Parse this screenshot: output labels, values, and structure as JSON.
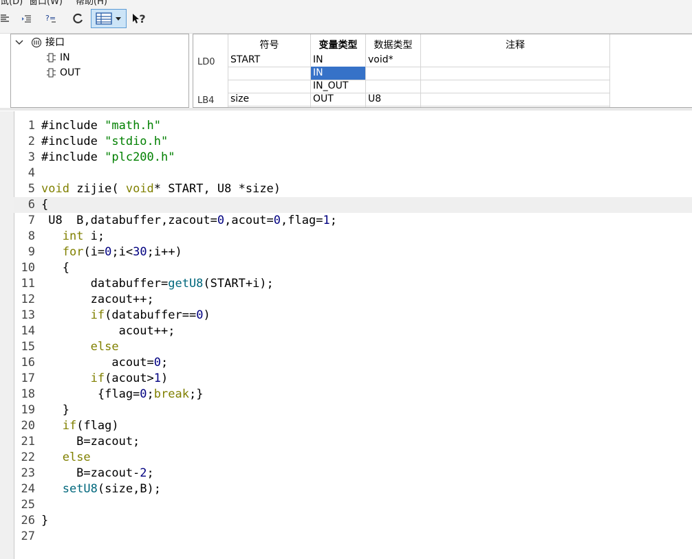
{
  "menu": [
    "试(D)",
    "窗口(W)",
    "帮助(H)"
  ],
  "toolbar": {
    "help_text": "?"
  },
  "tree": {
    "root": "接口",
    "children": [
      "IN",
      "OUT"
    ]
  },
  "grid": {
    "headers": [
      "符号",
      "变量类型",
      "数据类型",
      "注释"
    ],
    "row_labels": [
      "LD0",
      "LB4"
    ],
    "rows": [
      {
        "symbol": "START",
        "var_type": "IN",
        "data_type": "void*",
        "comment": ""
      },
      {
        "symbol": "",
        "var_type": "IN",
        "data_type": "",
        "comment": ""
      },
      {
        "symbol": "",
        "var_type": "IN_OUT",
        "data_type": "",
        "comment": ""
      },
      {
        "symbol": "size",
        "var_type": "OUT",
        "data_type": "U8",
        "comment": ""
      }
    ],
    "selected_row": 1
  },
  "editor": {
    "current_line": 6,
    "lines": [
      [
        [
          "p",
          "#include "
        ],
        [
          "s",
          "\"math.h\""
        ]
      ],
      [
        [
          "p",
          "#include "
        ],
        [
          "s",
          "\"stdio.h\""
        ]
      ],
      [
        [
          "p",
          "#include "
        ],
        [
          "s",
          "\"plc200.h\""
        ]
      ],
      [],
      [
        [
          "k",
          "void"
        ],
        [
          "p",
          " zijie( "
        ],
        [
          "k",
          "void"
        ],
        [
          "p",
          "* START, U8 *size)"
        ]
      ],
      [
        [
          "p",
          "{"
        ]
      ],
      [
        [
          "p",
          " U8  B,databuffer,zacout="
        ],
        [
          "n",
          "0"
        ],
        [
          "p",
          ",acout="
        ],
        [
          "n",
          "0"
        ],
        [
          "p",
          ",flag="
        ],
        [
          "n",
          "1"
        ],
        [
          "p",
          ";"
        ]
      ],
      [
        [
          "p",
          "   "
        ],
        [
          "k",
          "int"
        ],
        [
          "p",
          " i;"
        ]
      ],
      [
        [
          "p",
          "   "
        ],
        [
          "k",
          "for"
        ],
        [
          "p",
          "(i="
        ],
        [
          "n",
          "0"
        ],
        [
          "p",
          ";i<"
        ],
        [
          "n",
          "30"
        ],
        [
          "p",
          ";i++)"
        ]
      ],
      [
        [
          "p",
          "   {"
        ]
      ],
      [
        [
          "p",
          "       databuffer="
        ],
        [
          "f",
          "getU8"
        ],
        [
          "p",
          "(START+i);"
        ]
      ],
      [
        [
          "p",
          "       zacout++;"
        ]
      ],
      [
        [
          "p",
          "       "
        ],
        [
          "k",
          "if"
        ],
        [
          "p",
          "(databuffer=="
        ],
        [
          "n",
          "0"
        ],
        [
          "p",
          ")"
        ]
      ],
      [
        [
          "p",
          "           acout++;"
        ]
      ],
      [
        [
          "p",
          "       "
        ],
        [
          "k",
          "else"
        ]
      ],
      [
        [
          "p",
          "          acout="
        ],
        [
          "n",
          "0"
        ],
        [
          "p",
          ";"
        ]
      ],
      [
        [
          "p",
          "       "
        ],
        [
          "k",
          "if"
        ],
        [
          "p",
          "(acout>"
        ],
        [
          "n",
          "1"
        ],
        [
          "p",
          ")"
        ]
      ],
      [
        [
          "p",
          "        {flag="
        ],
        [
          "n",
          "0"
        ],
        [
          "p",
          ";"
        ],
        [
          "k",
          "break"
        ],
        [
          "p",
          ";}"
        ]
      ],
      [
        [
          "p",
          "   }"
        ]
      ],
      [
        [
          "p",
          "   "
        ],
        [
          "k",
          "if"
        ],
        [
          "p",
          "(flag)"
        ]
      ],
      [
        [
          "p",
          "     B=zacout;"
        ]
      ],
      [
        [
          "p",
          "   "
        ],
        [
          "k",
          "else"
        ]
      ],
      [
        [
          "p",
          "     B=zacout-"
        ],
        [
          "n",
          "2"
        ],
        [
          "p",
          ";"
        ]
      ],
      [
        [
          "p",
          "   "
        ],
        [
          "f",
          "setU8"
        ],
        [
          "p",
          "(size,B);"
        ]
      ],
      [],
      [
        [
          "p",
          "}"
        ]
      ],
      []
    ]
  }
}
